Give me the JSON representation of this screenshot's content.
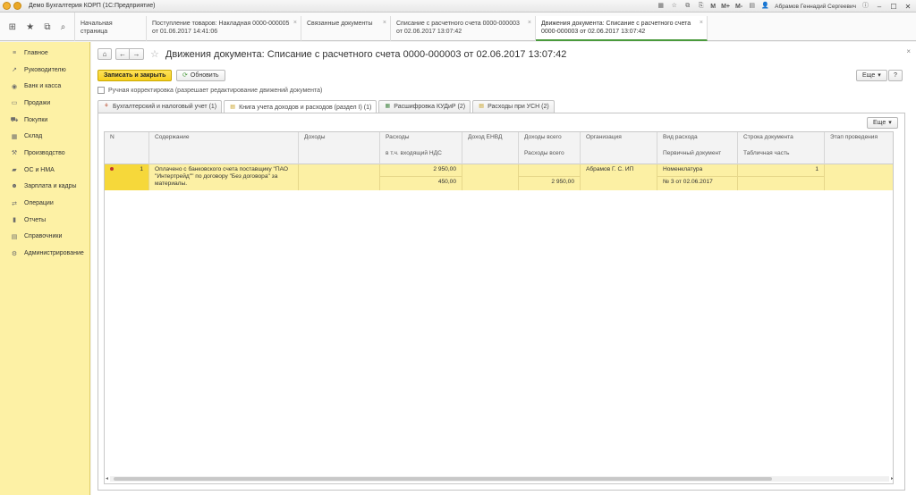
{
  "app": {
    "title": "Демо Бухгалтерия КОРП  (1С:Предприятие)"
  },
  "titlebar": {
    "m_labels": [
      "M",
      "M+",
      "M-"
    ],
    "user": "Абрамов Геннадий Сергеевич"
  },
  "tabs": [
    {
      "line1": "Начальная страница",
      "line2": ""
    },
    {
      "line1": "Поступление товаров: Накладная 0000-000005",
      "line2": "от 01.06.2017 14:41:06"
    },
    {
      "line1": "Связанные документы",
      "line2": ""
    },
    {
      "line1": "Списание с расчетного счета 0000-000003",
      "line2": "от 02.06.2017 13:07:42"
    },
    {
      "line1": "Движения документа: Списание с расчетного счета",
      "line2": "0000-000003 от 02.06.2017 13:07:42"
    }
  ],
  "sidebar": {
    "items": [
      {
        "label": "Главное",
        "icon": "menu-icon"
      },
      {
        "label": "Руководителю",
        "icon": "trend-icon"
      },
      {
        "label": "Банк и касса",
        "icon": "bank-icon"
      },
      {
        "label": "Продажи",
        "icon": "sales-icon"
      },
      {
        "label": "Покупки",
        "icon": "cart-icon"
      },
      {
        "label": "Склад",
        "icon": "warehouse-icon"
      },
      {
        "label": "Производство",
        "icon": "production-icon"
      },
      {
        "label": "ОС и НМА",
        "icon": "truck-icon"
      },
      {
        "label": "Зарплата и кадры",
        "icon": "people-icon"
      },
      {
        "label": "Операции",
        "icon": "operations-icon"
      },
      {
        "label": "Отчеты",
        "icon": "chart-icon"
      },
      {
        "label": "Справочники",
        "icon": "book-icon"
      },
      {
        "label": "Администрирование",
        "icon": "gear-icon"
      }
    ]
  },
  "form": {
    "title": "Движения документа: Списание с расчетного счета 0000-000003 от 02.06.2017 13:07:42",
    "save_close": "Записать и закрыть",
    "refresh": "Обновить",
    "more": "Еще",
    "help": "?",
    "manual_check": "Ручная корректировка (разрешает редактирование движений документа)"
  },
  "subtabs": [
    {
      "label": "Бухгалтерский и налоговый учет (1)"
    },
    {
      "label": "Книга учета доходов и расходов (раздел I) (1)"
    },
    {
      "label": "Расшифровка КУДиР (2)"
    },
    {
      "label": "Расходы при УСН (2)"
    }
  ],
  "table": {
    "more": "Еще",
    "headers": {
      "n": "N",
      "content": "Содержание",
      "income": "Доходы",
      "expenses": "Расходы",
      "expenses_sub": "в т.ч. входящий НДС",
      "envd": "Доход ЕНВД",
      "income_total": "Доходы всего",
      "income_total_sub": "Расходы всего",
      "org": "Организация",
      "expense_kind": "Вид расхода",
      "expense_kind_sub": "Первичный документ",
      "doc_line": "Строка документа",
      "doc_line_sub": "Табличная часть",
      "stage": "Этап проведения"
    },
    "row": {
      "n": "1",
      "content": "Оплачено с банковского счета поставщику \"ПАО \"Интертрейд\"\" по договору \"Без договора\" за материалы.",
      "expenses": "2 950,00",
      "vat": "450,00",
      "total_expenses": "2 950,00",
      "org": "Абрамов Г. С. ИП",
      "expense_kind": "Номенклатура",
      "primary_doc": "№ 3 от 02.06.2017",
      "doc_line": "1"
    }
  }
}
